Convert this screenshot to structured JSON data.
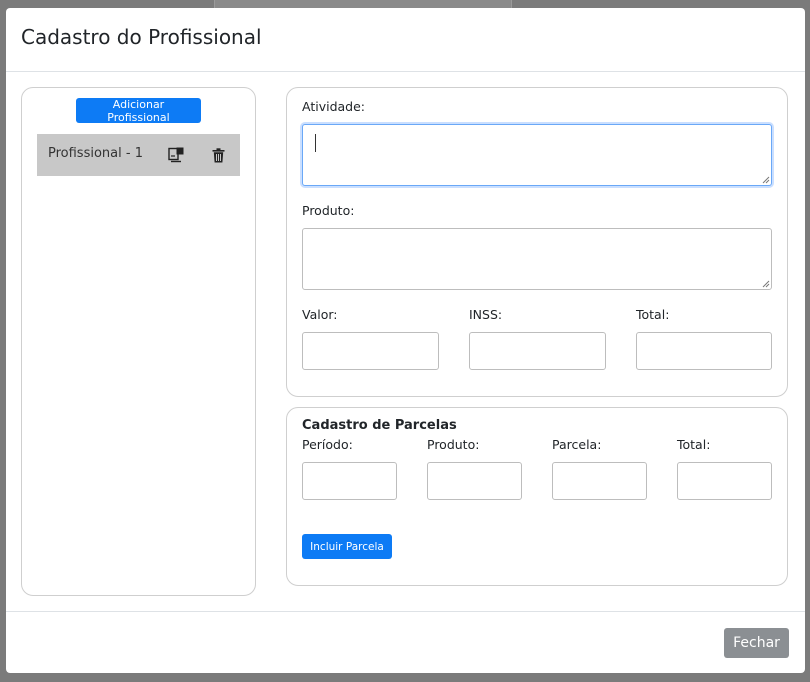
{
  "modal": {
    "title": "Cadastro do Profissional"
  },
  "left_panel": {
    "add_button_label": "Adicionar Profissional",
    "items": [
      {
        "label": "Profissional - 1",
        "edit_icon": "edit-icon",
        "delete_icon": "trash-icon"
      }
    ]
  },
  "form": {
    "atividade_label": "Atividade:",
    "atividade_value": "",
    "produto_label": "Produto:",
    "produto_value": "",
    "valor_label": "Valor:",
    "inss_label": "INSS:",
    "total_label": "Total:"
  },
  "parcelas": {
    "title": "Cadastro de Parcelas",
    "periodo_label": "Período:",
    "produto_label": "Produto:",
    "parcela_label": "Parcela:",
    "total_label": "Total:",
    "incluir_button_label": "Incluir Parcela"
  },
  "footer": {
    "close_button_label": "Fechar"
  },
  "colors": {
    "primary": "#0d7bf5",
    "secondary": "#8b8f93",
    "selected_item_bg": "#c8c8c8"
  }
}
